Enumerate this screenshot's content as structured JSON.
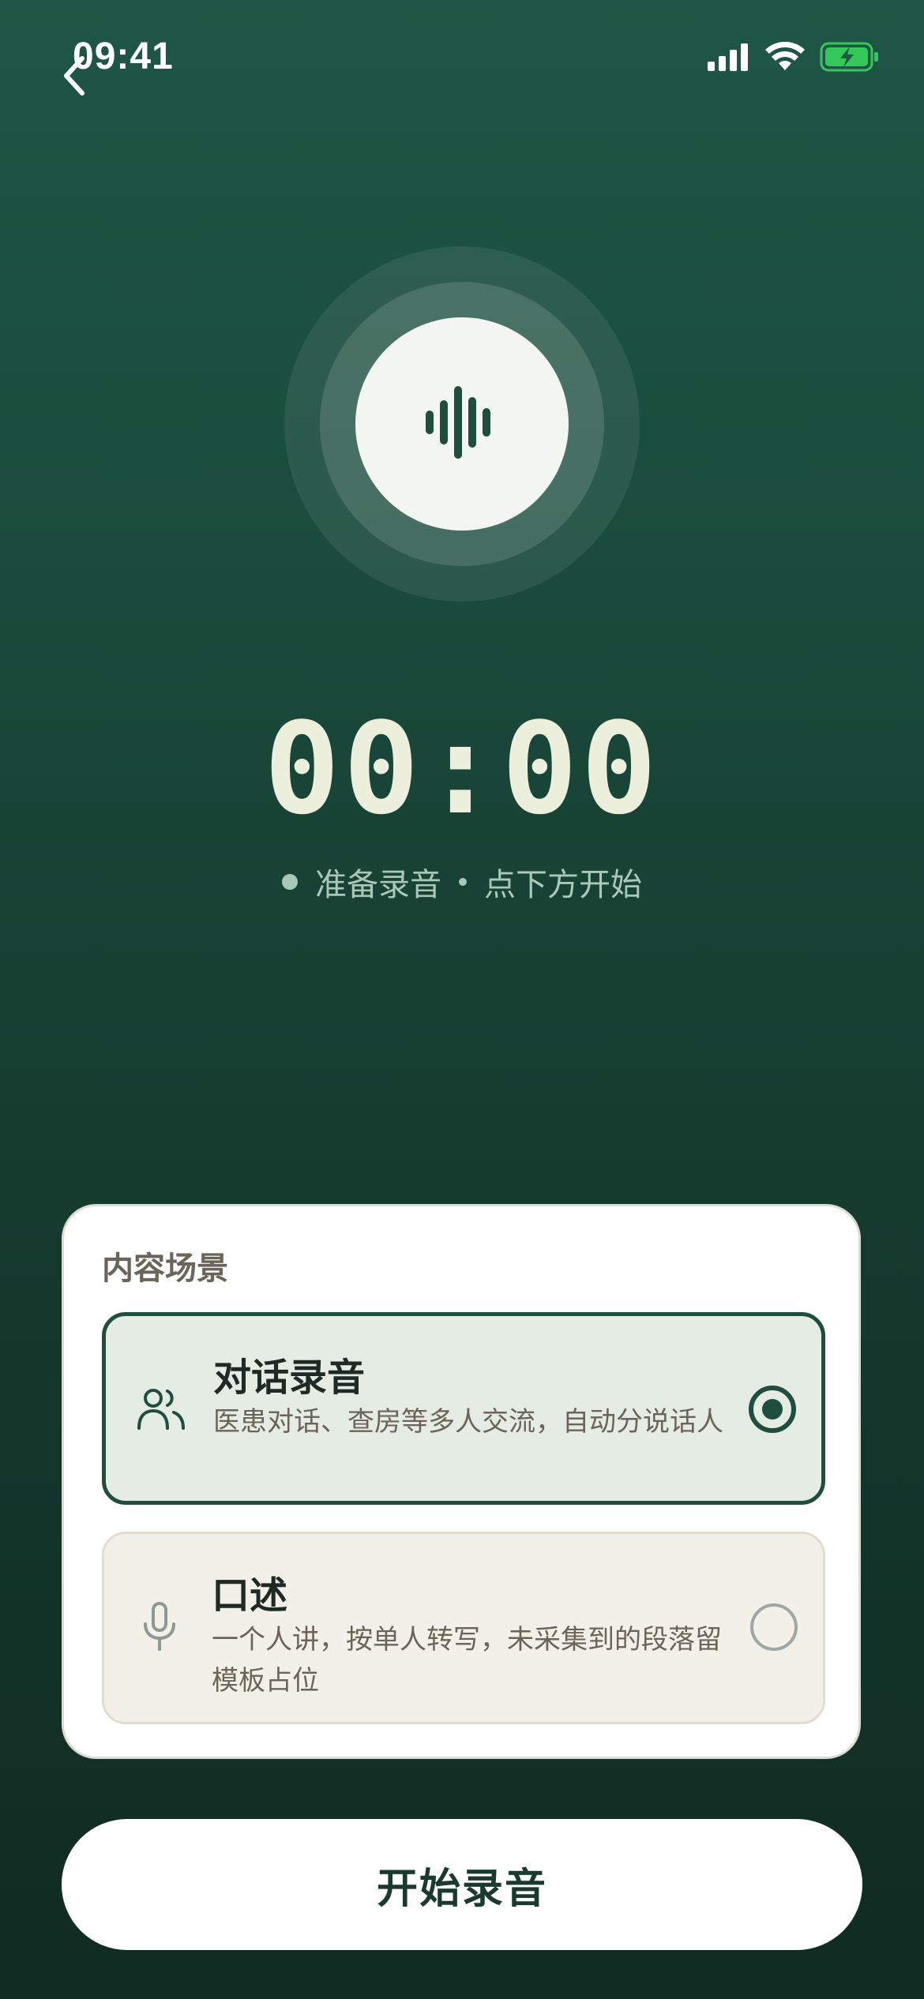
{
  "status_bar": {
    "time": "09:41",
    "icons": [
      "signal-icon",
      "wifi-icon",
      "battery-charging-icon"
    ]
  },
  "header": {
    "back_icon": "chevron-left-icon"
  },
  "recorder": {
    "mic_icon": "waveform-icon",
    "timer": "00:00",
    "status_primary": "准备录音",
    "status_secondary": "点下方开始"
  },
  "scene": {
    "title": "内容场景",
    "options": [
      {
        "title": "对话录音",
        "description": "医患对话、查房等多人交流，自动分说话人",
        "icon": "users-icon",
        "selected": true
      },
      {
        "title": "口述",
        "description": "一个人讲，按单人转写，未采集到的段落留模板占位",
        "icon": "microphone-icon",
        "selected": false
      }
    ]
  },
  "actions": {
    "start_label": "开始录音"
  },
  "colors": {
    "accent": "#1f4e3f",
    "timer": "#ecefdc",
    "status_text": "#a9c8b9",
    "battery_fill": "#34c759"
  }
}
